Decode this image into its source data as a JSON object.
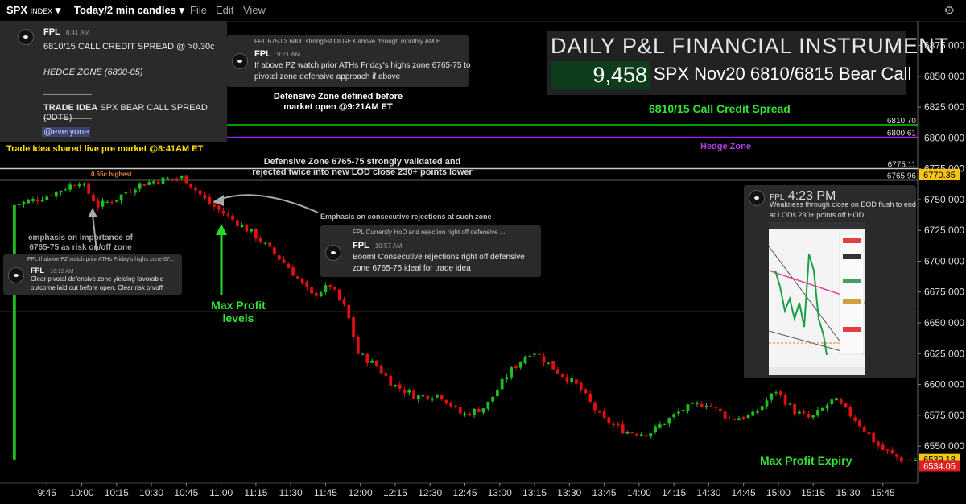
{
  "topbar": {
    "symbol": "SPX",
    "symbol_sub": "INDEX",
    "timeframe": "Today/2 min candles",
    "menu_file": "File",
    "menu_edit": "Edit",
    "menu_view": "View"
  },
  "chart_data": {
    "type": "candlestick",
    "ylim": [
      6520,
      6895
    ],
    "yticks": [
      6550,
      6575,
      6600,
      6625,
      6650,
      6675,
      6700,
      6725,
      6750,
      6775,
      6800,
      6825,
      6850,
      6875
    ],
    "xticks": [
      "9:45",
      "10:00",
      "10:15",
      "10:30",
      "10:45",
      "11:00",
      "11:15",
      "11:30",
      "11:45",
      "12:00",
      "12:15",
      "12:30",
      "12:45",
      "13:00",
      "13:15",
      "13:30",
      "13:45",
      "14:00",
      "14:15",
      "14:30",
      "14:45",
      "15:00",
      "15:15",
      "15:30",
      "15:45"
    ],
    "session_start": "9:30",
    "minutes_per_candle": 2,
    "close_path": [
      {
        "t": "9:31",
        "p": 6745
      },
      {
        "t": "9:45",
        "p": 6752
      },
      {
        "t": "10:00",
        "p": 6765
      },
      {
        "t": "10:08",
        "p": 6745
      },
      {
        "t": "10:15",
        "p": 6750
      },
      {
        "t": "10:25",
        "p": 6762
      },
      {
        "t": "10:35",
        "p": 6766
      },
      {
        "t": "10:45",
        "p": 6768
      },
      {
        "t": "10:55",
        "p": 6748
      },
      {
        "t": "11:05",
        "p": 6735
      },
      {
        "t": "11:15",
        "p": 6722
      },
      {
        "t": "11:30",
        "p": 6695
      },
      {
        "t": "11:40",
        "p": 6672
      },
      {
        "t": "11:48",
        "p": 6680
      },
      {
        "t": "11:55",
        "p": 6660
      },
      {
        "t": "12:00",
        "p": 6625
      },
      {
        "t": "12:08",
        "p": 6615
      },
      {
        "t": "12:15",
        "p": 6600
      },
      {
        "t": "12:25",
        "p": 6590
      },
      {
        "t": "12:35",
        "p": 6592
      },
      {
        "t": "12:45",
        "p": 6575
      },
      {
        "t": "12:55",
        "p": 6582
      },
      {
        "t": "13:05",
        "p": 6610
      },
      {
        "t": "13:15",
        "p": 6628
      },
      {
        "t": "13:25",
        "p": 6612
      },
      {
        "t": "13:35",
        "p": 6598
      },
      {
        "t": "13:45",
        "p": 6572
      },
      {
        "t": "13:55",
        "p": 6562
      },
      {
        "t": "14:05",
        "p": 6560
      },
      {
        "t": "14:20",
        "p": 6580
      },
      {
        "t": "14:30",
        "p": 6585
      },
      {
        "t": "14:40",
        "p": 6572
      },
      {
        "t": "14:50",
        "p": 6575
      },
      {
        "t": "15:00",
        "p": 6595
      },
      {
        "t": "15:08",
        "p": 6578
      },
      {
        "t": "15:15",
        "p": 6572
      },
      {
        "t": "15:25",
        "p": 6588
      },
      {
        "t": "15:35",
        "p": 6570
      },
      {
        "t": "15:45",
        "p": 6548
      },
      {
        "t": "15:55",
        "p": 6538
      },
      {
        "t": "16:00",
        "p": 6539
      }
    ],
    "levels": [
      {
        "value": 6810.7,
        "label": "6810.70",
        "color": "#00d000"
      },
      {
        "value": 6800.61,
        "label": "6800.61",
        "color": "#a020f0"
      },
      {
        "value": 6775.11,
        "label": "6775.11",
        "color": "#c8c8c8"
      },
      {
        "value": 6765.96,
        "label": "6765.96",
        "color": "#c8c8c8"
      },
      {
        "value": 6659,
        "label": "",
        "color": "#5a5a5a"
      }
    ],
    "price_badges": [
      {
        "value": 6770.35,
        "label": "6770.35",
        "bg": "#f5c518",
        "fg": "#000"
      },
      {
        "value": 6539.18,
        "label": "6539.18",
        "bg": "#f5c518",
        "fg": "#000"
      },
      {
        "value": 6534.05,
        "label": "6534.05",
        "bg": "#e02020",
        "fg": "#fff"
      }
    ],
    "up_color": "#1fbf1f",
    "down_color": "#e01010"
  },
  "pl_box": {
    "title": "DAILY P&L FINANCIAL INSTRUMENT",
    "value": "9,458",
    "description": "SPX  Nov20  6810/6815 Bear Call"
  },
  "annotations": {
    "spread_label": "6810/15 Call Credit Spread",
    "hedge_label": "Hedge Zone",
    "trade_idea": "Trade Idea shared live pre market @8:41AM ET",
    "defensive_line1": "Defensive Zone defined before",
    "defensive_line2": "market open @9:21AM ET",
    "validated_line1": "Defensive Zone 6765-75 strongly validated and",
    "validated_line2": "rejected twice into new LOD close 230+ points lower",
    "highest": "0.65c highest",
    "emphasis_line1": "emphasis on importance of",
    "emphasis_line2": "6765-75 as risk on/off zone",
    "consecutive": "Emphasis on consecutive rejections at such zone",
    "max_profit_line1": "Max Profit",
    "max_profit_line2": "levels",
    "max_profit_expiry": "Max Profit Expiry"
  },
  "messages": {
    "m1": {
      "name": "FPL",
      "time": "8:41 AM",
      "line1": "6810/15 CALL CREDIT SPREAD @ >0.30c",
      "line2": "HEDGE ZONE (6800-05)",
      "sep1": "——————",
      "trade_bold": "TRADE IDEA",
      "trade_rest": " SPX BEAR CALL SPREAD (0DTE)",
      "sep2": "——————",
      "mention": "@everyone"
    },
    "m2": {
      "reply": "FPL 6750 > 6800 strongest OI GEX above through monthly AM E...",
      "name": "FPL",
      "time": "9:21 AM",
      "line1": "If above PZ watch prior ATHs Friday's highs zone 6765-75 to",
      "line2": "pivotal zone defensive approach if above"
    },
    "m3": {
      "reply": "FPL If above PZ watch prior ATHs Friday's highs zone 67...",
      "name": "FPL",
      "time": "10:12 AM",
      "line1": "Clear pivotal defensive zone yielding favorable",
      "line2": "outcome laid out before open. Clear risk on/off"
    },
    "m4": {
      "reply": "FPL Currently HoD and rejection right off defensive ...",
      "name": "FPL",
      "time": "10:57 AM",
      "line1": "Boom! Consecutive rejections right off defensive",
      "line2": "zone 6765-75 ideal for trade idea"
    },
    "m5": {
      "name": "FPL",
      "time": "4:23 PM",
      "line1": "Weakness through close on EOD flush to end",
      "line2": "at LODs 230+ points off HOD"
    }
  }
}
